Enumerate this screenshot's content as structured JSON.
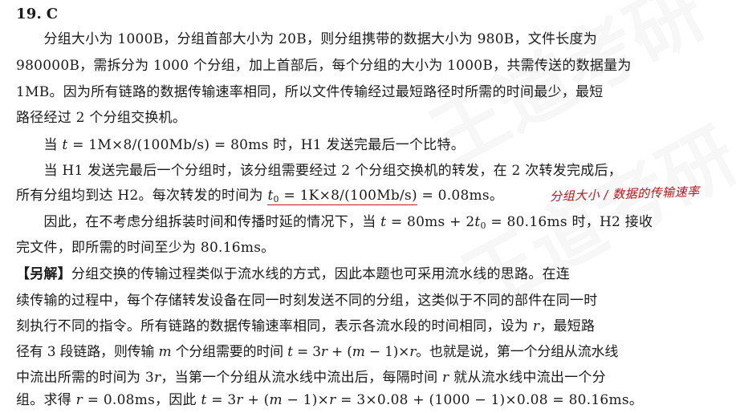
{
  "watermark": {
    "text": "王道考研"
  },
  "question": {
    "number": "19.",
    "answer": "C",
    "paragraphs": [
      [
        "　　分组大小为 1000B，分组首部大小为 20B，则分组携带的数据大小为 980B，文件长度为"
      ],
      [
        "980000B，需拆分为 1000 个分组，加上首部后，每个分组的大小为 1000B，共需传送的数据量为"
      ],
      [
        "1MB。因为所有链路的数据传输速率相同，所以文件传输经过最短路径时所需的时间最少，最短"
      ],
      [
        "路径经过 2 个分组交换机。"
      ]
    ],
    "p2": {
      "pre": "　　当 ",
      "var": "t",
      "post": " = 1M×8/(100Mb/s) = 80ms 时，H1 发送完最后一个比特。"
    },
    "p3_line1": "　　当 H1 发送完最后一个分组时，该分组需要经过 2 个分组交换机的转发，在 2 次转发完成后，",
    "p3_line2": {
      "pre": "所有分组均到达 H2。每次转发的时间为 ",
      "var": "t",
      "sub": "0",
      "eq": " = 1K×8/(100Mb/s)",
      "post": " = 0.08ms。"
    },
    "handwritten_note": "分组大小 / 数据的传输速率",
    "p4_line1": {
      "pre": "　　因此，在不考虑分组拆装时间和传播时延的情况下，当 ",
      "var": "t",
      "mid": " = 80ms + 2",
      "var2": "t",
      "sub": "0",
      "post": " = 80.16ms 时，H2 接收"
    },
    "p4_line2": "完文件，即所需的时间至少为 80.16ms。",
    "alt": {
      "bracket": "【另解】",
      "line1": "分组交换的传输过程类似于流水线的方式，因此本题也可采用流水线的思路。在连",
      "line2": "续传输的过程中，每个存储转发设备在同一时刻发送不同的分组，这类似于不同的部件在同一时",
      "line3": {
        "pre": "刻执行不同的指令。所有链路的数据传输速率相同，表示各流水段的时间相同，设为 ",
        "var": "r",
        "post": "，最短路"
      },
      "line4": {
        "pre": "径有 3 段链路，则传输 ",
        "var": "m",
        "mid": " 个分组需要的时间 ",
        "formula": [
          {
            "t": "i",
            "v": "t"
          },
          {
            "t": "n",
            "v": " = 3"
          },
          {
            "t": "i",
            "v": "r"
          },
          {
            "t": "n",
            "v": " + ("
          },
          {
            "t": "i",
            "v": "m"
          },
          {
            "t": "n",
            "v": " − 1)×"
          },
          {
            "t": "i",
            "v": "r"
          }
        ],
        "post": "。也就是说，第一个分组从流水线"
      },
      "line5": {
        "pre": "中流出所需的时间为 3",
        "var": "r",
        "mid": "，当第一个分组从流水线中流出后，每隔时间 ",
        "var2": "r",
        "post": " 就从流水线中流出一个分"
      },
      "line6": {
        "pre": "组。求得 ",
        "var": "r",
        "mid": " = 0.08ms，因此 ",
        "formula": [
          {
            "t": "i",
            "v": "t"
          },
          {
            "t": "n",
            "v": " = 3"
          },
          {
            "t": "i",
            "v": "r"
          },
          {
            "t": "n",
            "v": " + ("
          },
          {
            "t": "i",
            "v": "m"
          },
          {
            "t": "n",
            "v": " − 1)×"
          },
          {
            "t": "i",
            "v": "r"
          },
          {
            "t": "n",
            "v": " = 3×0.08 + (1000 − 1)×0.08 = 80.16ms。"
          }
        ]
      }
    }
  },
  "colors": {
    "annotation": "#c8102e",
    "text": "#1a1a1a"
  }
}
